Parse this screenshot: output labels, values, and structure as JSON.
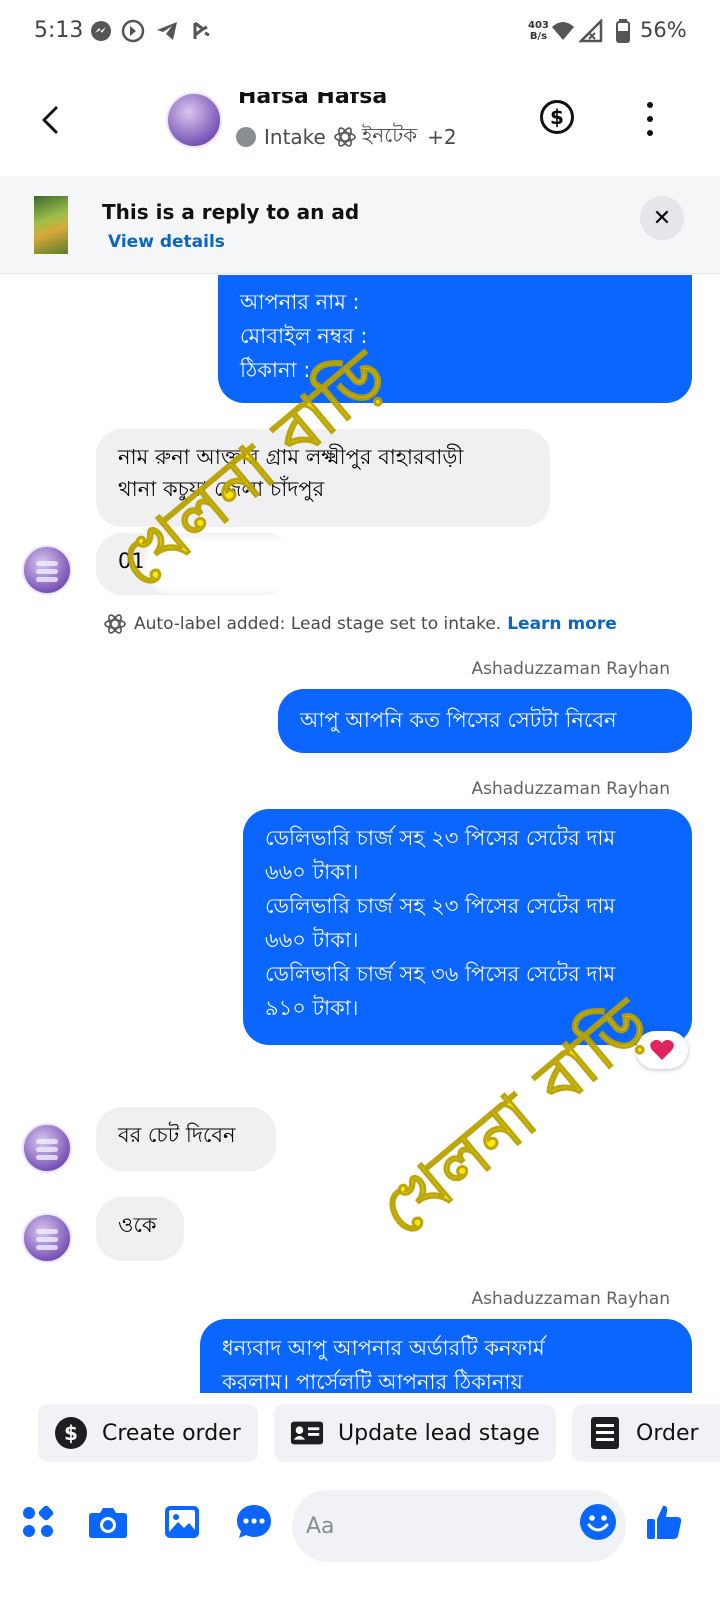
{
  "status_bar": {
    "time": "5:13",
    "net_speed_top": "403",
    "net_speed_bottom": "B/s",
    "battery": "56%"
  },
  "header": {
    "contact_name": "Hafsa Hafsa",
    "label_1": "Intake",
    "label_2": "ইনটেক",
    "label_more": "+2"
  },
  "ad_banner": {
    "title": "This is a reply to an ad",
    "link": "View details"
  },
  "messages": {
    "m1_line1": "আপনার নাম :",
    "m1_line2": "মোবাইল নম্বর :",
    "m1_line3": "ঠিকানা :",
    "m2_line1": "নাম রুনা আক্তার গ্রাম লক্ষ্মীপুর বাহারবাড়ী",
    "m2_line2": "থানা কচুয়া জেলা চাঁদপুর",
    "m3": "01",
    "system_text": "Auto-label added: Lead stage set to intake.",
    "system_link": "Learn more",
    "sender_1": "Ashaduzzaman Rayhan",
    "m4": "আপু আপনি কত পিসের সেটটা নিবেন",
    "sender_2": "Ashaduzzaman Rayhan",
    "m5_line1": "ডেলিভারি চার্জ সহ ২৩ পিসের সেটের দাম",
    "m5_line2": "৬৬০ টাকা।",
    "m5_line3": "ডেলিভারি চার্জ সহ ২৩ পিসের সেটের দাম",
    "m5_line4": "৬৬০ টাকা।",
    "m5_line5": "ডেলিভারি চার্জ সহ ৩৬ পিসের সেটের দাম",
    "m5_line6": "৯১০ টাকা।",
    "m6": "বর চেট দিবেন",
    "m7": "ওকে",
    "sender_3": "Ashaduzzaman Rayhan",
    "m8_line1": "ধন্যবাদ আপু আপনার অর্ডারটি কনফার্ম",
    "m8_line2": "করলাম। পার্সেলটি আপনার ঠিকানায়"
  },
  "watermark": {
    "text_1": "খেলনা বাড়ি",
    "text_2": "খেলনা বাড়ি"
  },
  "quick_actions": {
    "create_order": "Create order",
    "update_lead_stage": "Update lead stage",
    "order": "Order"
  },
  "composer": {
    "placeholder": "Aa"
  },
  "colors": {
    "accent": "#0A66FF",
    "incoming_bubble": "#F0F0F2",
    "watermark": "#FFE600",
    "reaction": "#E0245E"
  },
  "icons": {
    "reaction": "heart-icon"
  }
}
